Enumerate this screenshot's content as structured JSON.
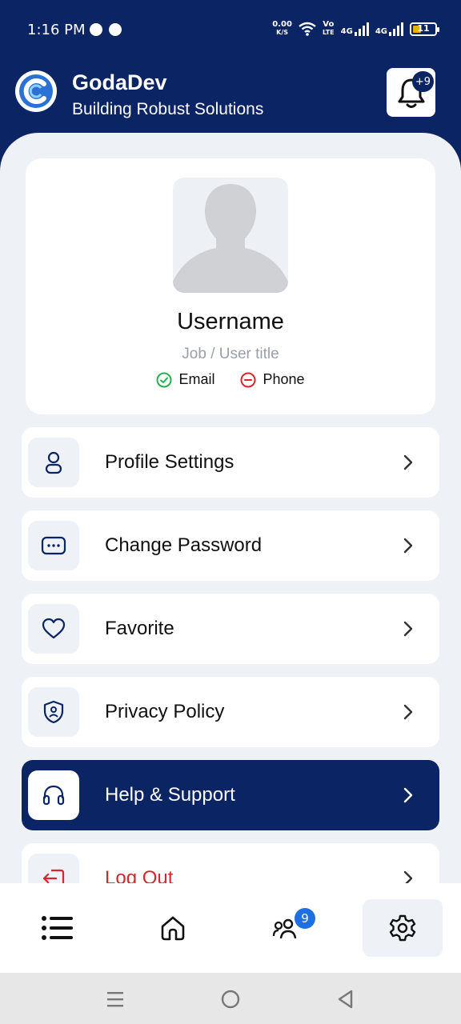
{
  "status_bar": {
    "time": "1:16 PM",
    "net_speed_value": "0.00",
    "net_speed_unit": "K/S",
    "volte_top": "Vo",
    "volte_bottom": "LTE",
    "sig1_label": "4G",
    "sig2_label": "4G",
    "battery": "11"
  },
  "header": {
    "title": "GodaDev",
    "subtitle": "Building Robust Solutions",
    "notification_badge": "+9",
    "accent_color": "#0b2464"
  },
  "profile": {
    "username": "Username",
    "job_title": "Job / User title",
    "email_label": "Email",
    "email_status": "verified",
    "phone_label": "Phone",
    "phone_status": "unverified"
  },
  "menu": {
    "items": [
      {
        "label": "Profile Settings",
        "icon": "user-icon"
      },
      {
        "label": "Change Password",
        "icon": "password-icon"
      },
      {
        "label": "Favorite",
        "icon": "heart-icon"
      },
      {
        "label": "Privacy Policy",
        "icon": "shield-user-icon"
      },
      {
        "label": "Help & Support",
        "icon": "headphones-icon",
        "active": true
      },
      {
        "label": "Log Out",
        "icon": "logout-icon"
      }
    ]
  },
  "bottom_nav": {
    "items": [
      "list-icon",
      "home-icon",
      "users-icon",
      "settings-icon"
    ],
    "users_badge": "9",
    "active": "settings-icon"
  }
}
